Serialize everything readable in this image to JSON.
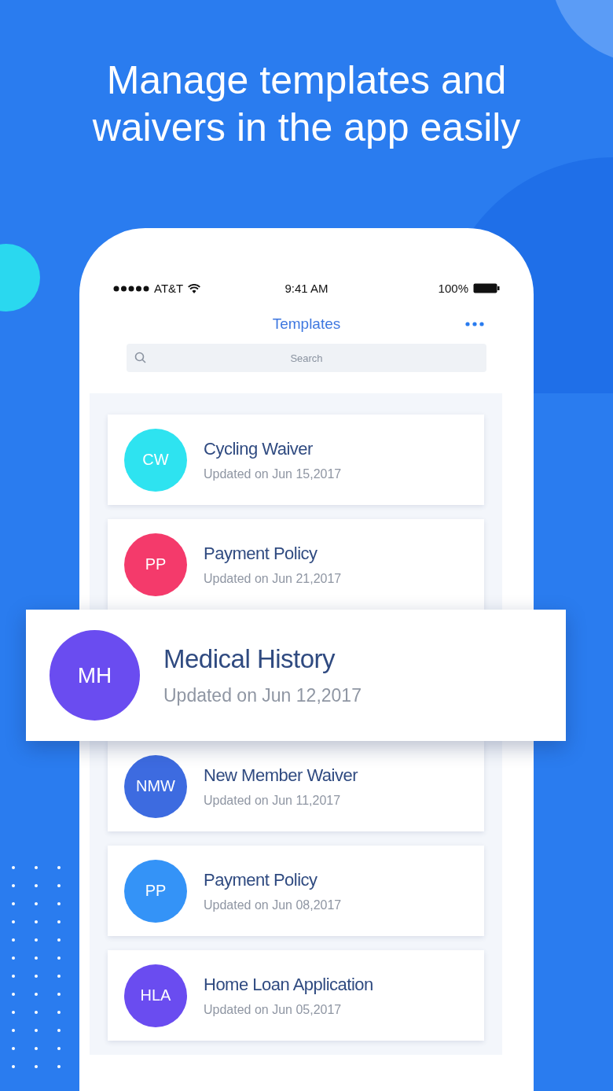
{
  "headline": [
    "Manage templates and",
    "waivers in the app easily"
  ],
  "status_bar": {
    "carrier": "AT&T",
    "time": "9:41 AM",
    "battery": "100%"
  },
  "nav": {
    "title": "Templates"
  },
  "search": {
    "placeholder": "Search"
  },
  "templates": [
    {
      "kind": "card",
      "initials": "CW",
      "title": "Cycling Waiver",
      "updated": "Updated on Jun 15,2017",
      "color": "#2ee3f0"
    },
    {
      "kind": "card",
      "initials": "PP",
      "title": "Payment Policy",
      "updated": "Updated on Jun 21,2017",
      "color": "#f43a6b"
    },
    {
      "kind": "featured",
      "initials": "MH",
      "title": "Medical History",
      "updated": "Updated on Jun 12,2017",
      "color": "#6a4cf0"
    },
    {
      "kind": "card",
      "initials": "NMW",
      "title": "New Member Waiver",
      "updated": "Updated on Jun 11,2017",
      "color": "#3d6be0"
    },
    {
      "kind": "card",
      "initials": "PP",
      "title": "Payment Policy",
      "updated": "Updated on Jun 08,2017",
      "color": "#3493f7"
    },
    {
      "kind": "card",
      "initials": "HLA",
      "title": "Home Loan Application",
      "updated": "Updated on Jun 05,2017",
      "color": "#6a4cf0"
    }
  ]
}
